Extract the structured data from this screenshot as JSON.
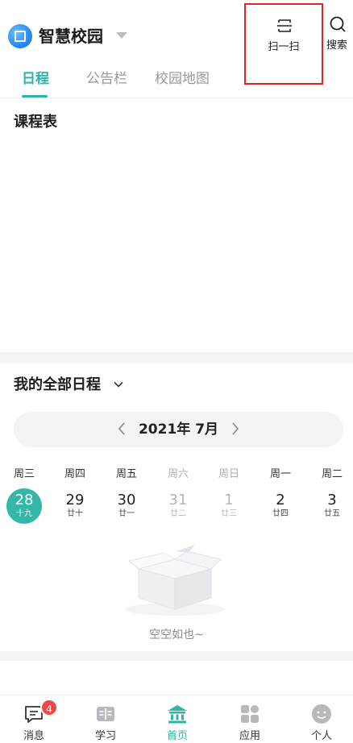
{
  "header": {
    "app_title": "智慧校园",
    "scan_label": "扫一扫",
    "search_label": "搜索"
  },
  "tabs": [
    {
      "label": "日程",
      "active": true
    },
    {
      "label": "公告栏",
      "active": false
    },
    {
      "label": "校园地图",
      "active": false
    }
  ],
  "timetable": {
    "title": "课程表"
  },
  "schedule": {
    "title": "我的全部日程",
    "month_label": "2021年 7月",
    "weekdays": [
      "周三",
      "周四",
      "周五",
      "周六",
      "周日",
      "周一",
      "周二"
    ],
    "dates": [
      {
        "day": "28",
        "lunar": "十九",
        "selected": true,
        "muted": false
      },
      {
        "day": "29",
        "lunar": "廿十",
        "selected": false,
        "muted": false
      },
      {
        "day": "30",
        "lunar": "廿一",
        "selected": false,
        "muted": false
      },
      {
        "day": "31",
        "lunar": "廿二",
        "selected": false,
        "muted": true
      },
      {
        "day": "1",
        "lunar": "廿三",
        "selected": false,
        "muted": true
      },
      {
        "day": "2",
        "lunar": "廿四",
        "selected": false,
        "muted": false
      },
      {
        "day": "3",
        "lunar": "廿五",
        "selected": false,
        "muted": false
      }
    ],
    "empty_text": "空空如也~"
  },
  "bottom_nav": [
    {
      "label": "消息",
      "icon": "message-icon",
      "badge": "4",
      "active": false
    },
    {
      "label": "学习",
      "icon": "book-icon",
      "active": false
    },
    {
      "label": "首页",
      "icon": "home-icon",
      "active": true
    },
    {
      "label": "应用",
      "icon": "apps-icon",
      "active": false
    },
    {
      "label": "个人",
      "icon": "profile-icon",
      "active": false
    }
  ],
  "colors": {
    "accent": "#2bb5a7",
    "highlight_border": "#e32323",
    "badge": "#f04848"
  }
}
